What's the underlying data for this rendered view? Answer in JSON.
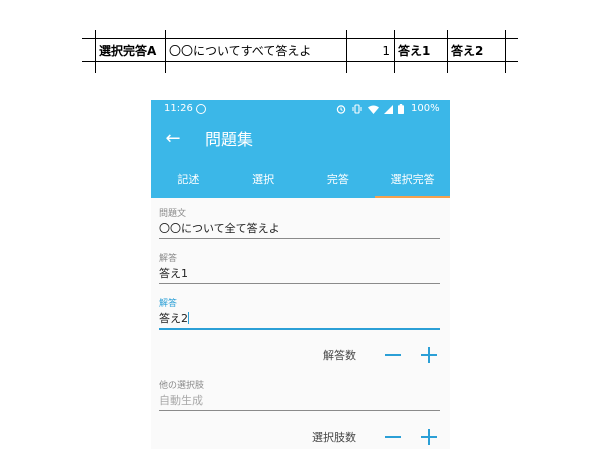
{
  "sheet": {
    "row": [
      "選択完答A",
      "〇〇についてすべて答えよ",
      "1",
      "答え1",
      "答え2"
    ]
  },
  "status_bar": {
    "time": "11:26",
    "battery": "100%"
  },
  "toolbar": {
    "back_icon": "arrow-back-icon",
    "title": "問題集"
  },
  "tabs": [
    {
      "label": "記述",
      "active": false
    },
    {
      "label": "選択",
      "active": false
    },
    {
      "label": "完答",
      "active": false
    },
    {
      "label": "選択完答",
      "active": true
    }
  ],
  "form": {
    "question": {
      "label": "問題文",
      "value": "〇〇について全て答えよ"
    },
    "answer1": {
      "label": "解答",
      "value": "答え1"
    },
    "answer2": {
      "label": "解答",
      "value": "答え2"
    },
    "answer_count": {
      "label": "解答数"
    },
    "other_choices": {
      "label": "他の選択肢",
      "placeholder": "自動生成"
    },
    "choice_count": {
      "label": "選択肢数"
    }
  },
  "colors": {
    "primary": "#3bb7e8",
    "accent": "#2b9fd6",
    "tab_indicator": "#f5a14e"
  }
}
